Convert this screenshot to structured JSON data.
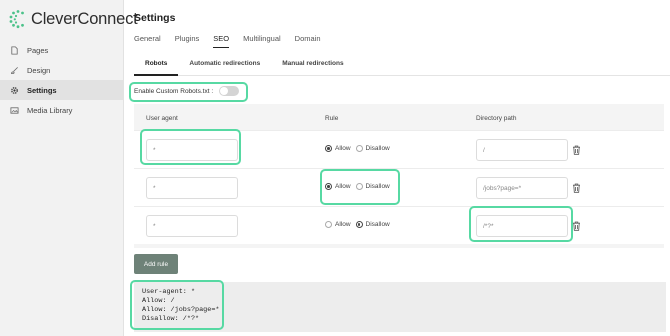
{
  "app": {
    "name": "CleverConnect"
  },
  "sidebar": {
    "items": [
      {
        "label": "Pages",
        "icon": "page-icon"
      },
      {
        "label": "Design",
        "icon": "brush-icon"
      },
      {
        "label": "Settings",
        "icon": "gear-icon",
        "active": true
      },
      {
        "label": "Media Library",
        "icon": "image-icon"
      }
    ]
  },
  "header": {
    "title": "Settings",
    "tabs": [
      "General",
      "Plugins",
      "SEO",
      "Multilingual",
      "Domain"
    ],
    "active_tab": "SEO"
  },
  "subtabs": {
    "items": [
      "Robots",
      "Automatic redirections",
      "Manual redirections"
    ],
    "active": "Robots"
  },
  "robots": {
    "enable_label": "Enable Custom Robots.txt :",
    "enabled": false,
    "columns": {
      "user_agent": "User agent",
      "rule": "Rule",
      "path": "Directory path"
    },
    "allow_label": "Allow",
    "disallow_label": "Disallow",
    "rules": [
      {
        "agent": "*",
        "rule": "Allow",
        "path": "/"
      },
      {
        "agent": "*",
        "rule": "Allow",
        "path": "/jobs?page=*"
      },
      {
        "agent": "*",
        "rule": "Disallow",
        "path": "/*?*"
      }
    ],
    "add_rule_label": "Add rule",
    "preview": [
      "User-agent: *",
      "Allow: /",
      "Allow: /jobs?page=*",
      "Disallow: /*?*"
    ]
  },
  "colors": {
    "highlight": "#57d9a3",
    "button": "#6e8278",
    "logo_green": "#4cc28a"
  }
}
